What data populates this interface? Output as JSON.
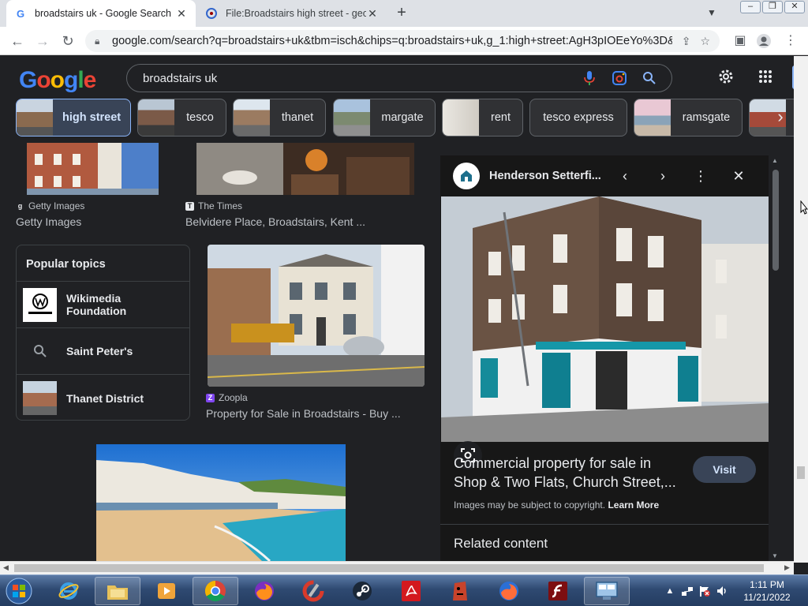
{
  "browser": {
    "tabs": [
      {
        "title": "broadstairs uk - Google Search",
        "favicon": "google-g-icon",
        "active": true
      },
      {
        "title": "File:Broadstairs high street - geog",
        "favicon": "wikimedia-icon",
        "active": false
      }
    ],
    "new_tab_label": "+",
    "url": "google.com/search?q=broadstairs+uk&tbm=isch&chips=q:broadstairs+uk,g_1:high+street:AgH3pIOEeYo%3D&..."
  },
  "google": {
    "logo_letters": [
      "G",
      "o",
      "o",
      "g",
      "l",
      "e"
    ],
    "search_query": "broadstairs uk",
    "chips": [
      {
        "label": "high street",
        "selected": true
      },
      {
        "label": "tesco",
        "selected": false
      },
      {
        "label": "thanet",
        "selected": false
      },
      {
        "label": "margate",
        "selected": false
      },
      {
        "label": "rent",
        "selected": false
      },
      {
        "label": "tesco express",
        "selected": false
      },
      {
        "label": "ramsgate",
        "selected": false
      }
    ]
  },
  "results": {
    "items": [
      {
        "source": "Getty Images",
        "title": "Getty Images"
      },
      {
        "source": "The Times",
        "title": "Belvidere Place, Broadstairs, Kent ..."
      },
      {
        "source": "Zoopla",
        "title": "Property for Sale in Broadstairs - Buy ..."
      }
    ],
    "popular_topics": {
      "heading": "Popular topics",
      "items": [
        "Wikimedia Foundation",
        "Saint Peter's",
        "Thanet District"
      ]
    }
  },
  "preview": {
    "site_name": "Henderson Setterfi...",
    "title_line1": "Commercial property for sale in",
    "title_line2": "Shop & Two Flats, Church Street,...",
    "visit_label": "Visit",
    "copyright_text": "Images may be subject to copyright.",
    "learn_more": "Learn More",
    "related_heading": "Related content"
  },
  "taskbar": {
    "time": "1:11 PM",
    "date": "11/21/2022"
  },
  "colors": {
    "page_bg": "#202124",
    "panel_bg": "#171717",
    "accent": "#8ab4f8",
    "selected_chip_bg": "#394457"
  }
}
